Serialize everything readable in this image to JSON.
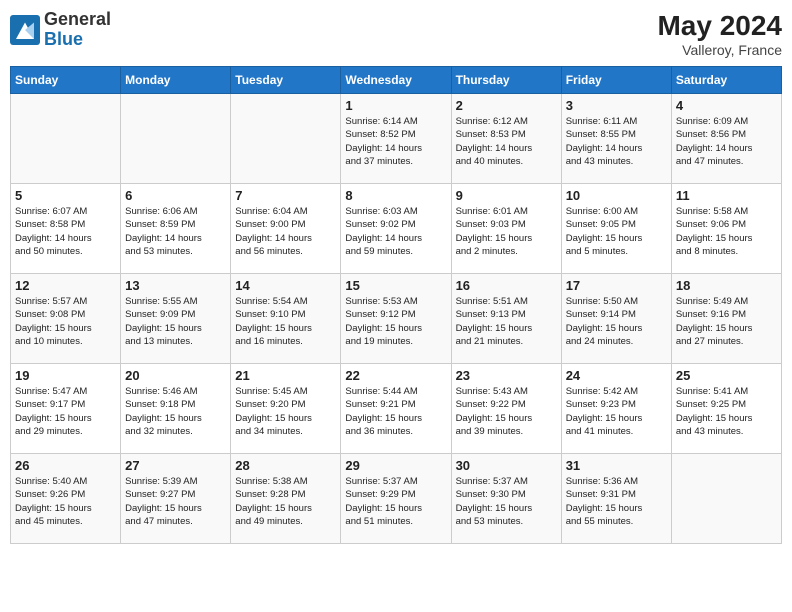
{
  "header": {
    "logo_general": "General",
    "logo_blue": "Blue",
    "month_year": "May 2024",
    "location": "Valleroy, France"
  },
  "days_of_week": [
    "Sunday",
    "Monday",
    "Tuesday",
    "Wednesday",
    "Thursday",
    "Friday",
    "Saturday"
  ],
  "weeks": [
    [
      {
        "day": "",
        "info": ""
      },
      {
        "day": "",
        "info": ""
      },
      {
        "day": "",
        "info": ""
      },
      {
        "day": "1",
        "info": "Sunrise: 6:14 AM\nSunset: 8:52 PM\nDaylight: 14 hours\nand 37 minutes."
      },
      {
        "day": "2",
        "info": "Sunrise: 6:12 AM\nSunset: 8:53 PM\nDaylight: 14 hours\nand 40 minutes."
      },
      {
        "day": "3",
        "info": "Sunrise: 6:11 AM\nSunset: 8:55 PM\nDaylight: 14 hours\nand 43 minutes."
      },
      {
        "day": "4",
        "info": "Sunrise: 6:09 AM\nSunset: 8:56 PM\nDaylight: 14 hours\nand 47 minutes."
      }
    ],
    [
      {
        "day": "5",
        "info": "Sunrise: 6:07 AM\nSunset: 8:58 PM\nDaylight: 14 hours\nand 50 minutes."
      },
      {
        "day": "6",
        "info": "Sunrise: 6:06 AM\nSunset: 8:59 PM\nDaylight: 14 hours\nand 53 minutes."
      },
      {
        "day": "7",
        "info": "Sunrise: 6:04 AM\nSunset: 9:00 PM\nDaylight: 14 hours\nand 56 minutes."
      },
      {
        "day": "8",
        "info": "Sunrise: 6:03 AM\nSunset: 9:02 PM\nDaylight: 14 hours\nand 59 minutes."
      },
      {
        "day": "9",
        "info": "Sunrise: 6:01 AM\nSunset: 9:03 PM\nDaylight: 15 hours\nand 2 minutes."
      },
      {
        "day": "10",
        "info": "Sunrise: 6:00 AM\nSunset: 9:05 PM\nDaylight: 15 hours\nand 5 minutes."
      },
      {
        "day": "11",
        "info": "Sunrise: 5:58 AM\nSunset: 9:06 PM\nDaylight: 15 hours\nand 8 minutes."
      }
    ],
    [
      {
        "day": "12",
        "info": "Sunrise: 5:57 AM\nSunset: 9:08 PM\nDaylight: 15 hours\nand 10 minutes."
      },
      {
        "day": "13",
        "info": "Sunrise: 5:55 AM\nSunset: 9:09 PM\nDaylight: 15 hours\nand 13 minutes."
      },
      {
        "day": "14",
        "info": "Sunrise: 5:54 AM\nSunset: 9:10 PM\nDaylight: 15 hours\nand 16 minutes."
      },
      {
        "day": "15",
        "info": "Sunrise: 5:53 AM\nSunset: 9:12 PM\nDaylight: 15 hours\nand 19 minutes."
      },
      {
        "day": "16",
        "info": "Sunrise: 5:51 AM\nSunset: 9:13 PM\nDaylight: 15 hours\nand 21 minutes."
      },
      {
        "day": "17",
        "info": "Sunrise: 5:50 AM\nSunset: 9:14 PM\nDaylight: 15 hours\nand 24 minutes."
      },
      {
        "day": "18",
        "info": "Sunrise: 5:49 AM\nSunset: 9:16 PM\nDaylight: 15 hours\nand 27 minutes."
      }
    ],
    [
      {
        "day": "19",
        "info": "Sunrise: 5:47 AM\nSunset: 9:17 PM\nDaylight: 15 hours\nand 29 minutes."
      },
      {
        "day": "20",
        "info": "Sunrise: 5:46 AM\nSunset: 9:18 PM\nDaylight: 15 hours\nand 32 minutes."
      },
      {
        "day": "21",
        "info": "Sunrise: 5:45 AM\nSunset: 9:20 PM\nDaylight: 15 hours\nand 34 minutes."
      },
      {
        "day": "22",
        "info": "Sunrise: 5:44 AM\nSunset: 9:21 PM\nDaylight: 15 hours\nand 36 minutes."
      },
      {
        "day": "23",
        "info": "Sunrise: 5:43 AM\nSunset: 9:22 PM\nDaylight: 15 hours\nand 39 minutes."
      },
      {
        "day": "24",
        "info": "Sunrise: 5:42 AM\nSunset: 9:23 PM\nDaylight: 15 hours\nand 41 minutes."
      },
      {
        "day": "25",
        "info": "Sunrise: 5:41 AM\nSunset: 9:25 PM\nDaylight: 15 hours\nand 43 minutes."
      }
    ],
    [
      {
        "day": "26",
        "info": "Sunrise: 5:40 AM\nSunset: 9:26 PM\nDaylight: 15 hours\nand 45 minutes."
      },
      {
        "day": "27",
        "info": "Sunrise: 5:39 AM\nSunset: 9:27 PM\nDaylight: 15 hours\nand 47 minutes."
      },
      {
        "day": "28",
        "info": "Sunrise: 5:38 AM\nSunset: 9:28 PM\nDaylight: 15 hours\nand 49 minutes."
      },
      {
        "day": "29",
        "info": "Sunrise: 5:37 AM\nSunset: 9:29 PM\nDaylight: 15 hours\nand 51 minutes."
      },
      {
        "day": "30",
        "info": "Sunrise: 5:37 AM\nSunset: 9:30 PM\nDaylight: 15 hours\nand 53 minutes."
      },
      {
        "day": "31",
        "info": "Sunrise: 5:36 AM\nSunset: 9:31 PM\nDaylight: 15 hours\nand 55 minutes."
      },
      {
        "day": "",
        "info": ""
      }
    ]
  ]
}
